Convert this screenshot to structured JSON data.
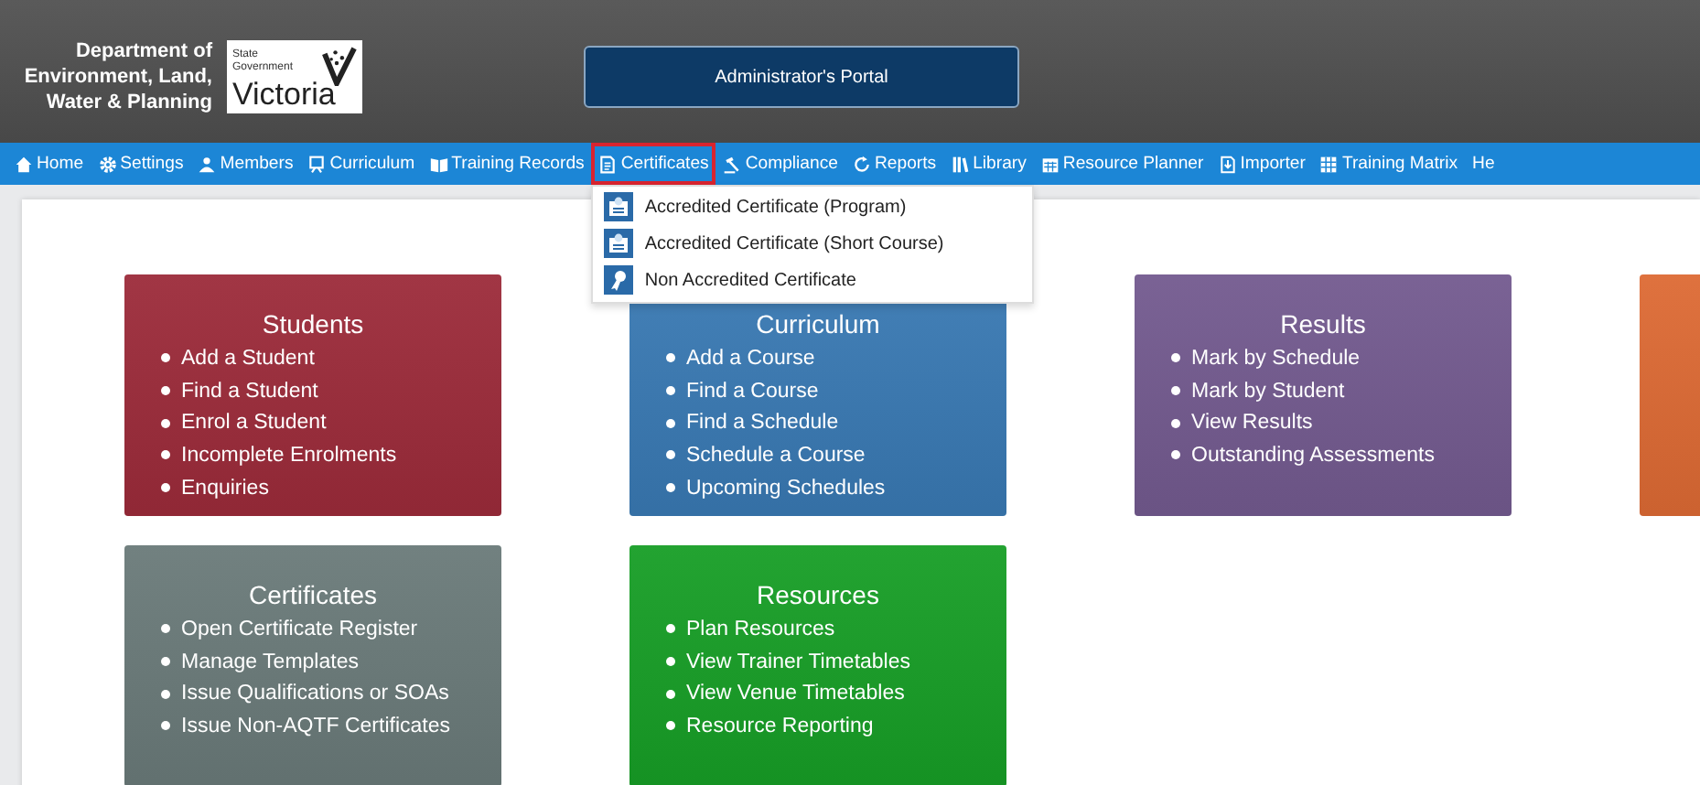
{
  "header": {
    "department": [
      "Department of",
      "Environment, Land,",
      "Water & Planning"
    ],
    "logo": {
      "small": [
        "State",
        "Government"
      ],
      "name": "Victoria"
    },
    "portal": "Administrator's Portal"
  },
  "nav": [
    {
      "label": "Home",
      "selected": false
    },
    {
      "label": "Settings",
      "selected": false
    },
    {
      "label": "Members",
      "selected": false
    },
    {
      "label": "Curriculum",
      "selected": false
    },
    {
      "label": "Training Records",
      "selected": false
    },
    {
      "label": "Certificates",
      "selected": true
    },
    {
      "label": "Compliance",
      "selected": false
    },
    {
      "label": "Reports",
      "selected": false
    },
    {
      "label": "Library",
      "selected": false
    },
    {
      "label": "Resource Planner",
      "selected": false
    },
    {
      "label": "Importer",
      "selected": false
    },
    {
      "label": "Training Matrix",
      "selected": false
    },
    {
      "label": "He",
      "selected": false
    }
  ],
  "dropdown": [
    {
      "label": "Accredited Certificate (Program)"
    },
    {
      "label": "Accredited Certificate (Short Course)"
    },
    {
      "label": "Non Accredited Certificate"
    }
  ],
  "cards": [
    {
      "title": "Students",
      "color": "#9c2b3a",
      "items": [
        "Add a Student",
        "Find a Student",
        "Enrol a Student",
        "Incomplete Enrolments",
        "Enquiries"
      ]
    },
    {
      "title": "Curriculum",
      "color": "#3979b3",
      "items": [
        "Add a Course",
        "Find a Course",
        "Find a Schedule",
        "Schedule a Course",
        "Upcoming Schedules"
      ]
    },
    {
      "title": "Results",
      "color": "#735a8f",
      "items": [
        "Mark by Schedule",
        "Mark by Student",
        "View Results",
        "Outstanding Assessments"
      ]
    },
    {
      "color": "#dd6a34"
    },
    {
      "title": "Certificates",
      "color": "#6a7a79",
      "items": [
        "Open Certificate Register",
        "Manage Templates",
        "Issue Qualifications or SOAs",
        "Issue Non-AQTF Certificates"
      ]
    },
    {
      "title": "Resources",
      "color": "#179e26",
      "items": [
        "Plan Resources",
        "View Trainer Timetables",
        "View Venue Timetables",
        "Resource Reporting"
      ]
    }
  ]
}
